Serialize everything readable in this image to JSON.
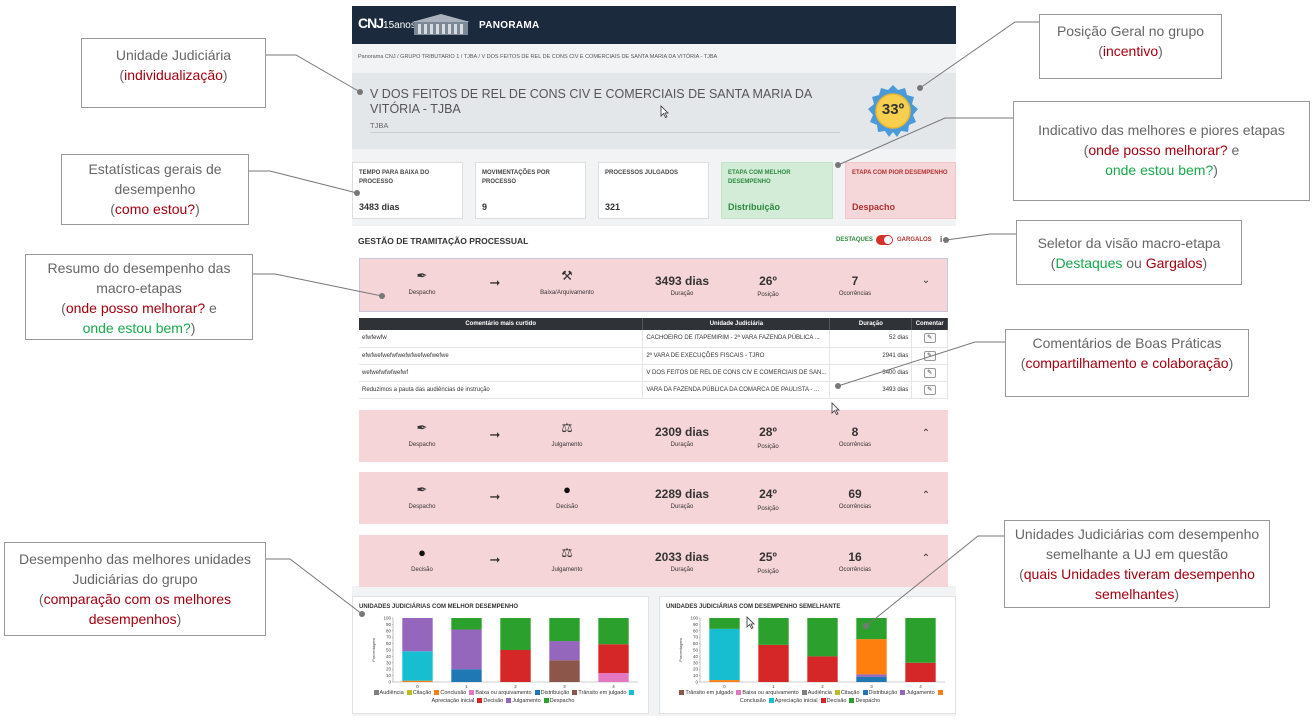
{
  "app": {
    "logo": "CNJ",
    "logo_sub": "15anos",
    "name": "PANORAMA"
  },
  "breadcrumb": "Panorama CNJ  /  GRUPO TRIBUTARIO 1  /  TJBA  /  V DOS FEITOS DE REL DE CONS CIV E COMERCIAIS DE SANTA MARIA DA VITÓRIA - TJBA",
  "unit": {
    "name": "V DOS FEITOS DE REL DE CONS CIV E COMERCIAIS DE SANTA MARIA DA VITÓRIA - TJBA",
    "court": "TJBA",
    "position": "33º"
  },
  "stats": [
    {
      "label": "TEMPO PARA BAIXA DO PROCESSO",
      "value": "3483 dias"
    },
    {
      "label": "MOVIMENTAÇÕES POR PROCESSO",
      "value": "9"
    },
    {
      "label": "PROCESSOS JULGADOS",
      "value": "321"
    },
    {
      "label": "ETAPA COM MELHOR DESEMPENHO",
      "value": "Distribuição"
    },
    {
      "label": "ETAPA COM PIOR DESEMPENHO",
      "value": "Despacho"
    }
  ],
  "section": {
    "title": "GESTÃO DE TRAMITAÇÃO PROCESSUAL",
    "toggle_left": "DESTAQUES",
    "toggle_right": "GARGALOS",
    "info": "i"
  },
  "labels": {
    "duration": "Duração",
    "position": "Posição",
    "occurrences": "Ocorrências",
    "arrow": "➞"
  },
  "stages": [
    {
      "from": "Despacho",
      "to": "Baixa/Arquivamento",
      "days": "3493 dias",
      "pos": "26º",
      "occ": "7",
      "chev": "⌄"
    },
    {
      "from": "Despacho",
      "to": "Julgamento",
      "days": "2309 dias",
      "pos": "28º",
      "occ": "8",
      "chev": "⌃"
    },
    {
      "from": "Despacho",
      "to": "Decisão",
      "days": "2289 dias",
      "pos": "24º",
      "occ": "69",
      "chev": "⌃"
    },
    {
      "from": "Decisão",
      "to": "Julgamento",
      "days": "2033 dias",
      "pos": "25º",
      "occ": "16",
      "chev": "⌃"
    }
  ],
  "comments": {
    "headers": [
      "Comentário mais curtido",
      "Unidade Judiciária",
      "Duração",
      "Comentar"
    ],
    "rows": [
      [
        "efwfewfw",
        "CACHOEIRO DE ITAPEMIRIM - 2ª VARA FAZENDA PÚBLICA ...",
        "52 dias"
      ],
      [
        "efwfwefwefwfwefwfwefwefwefwe",
        "2ª VARA DE EXECUÇÕES FISCAIS - TJRO",
        "2941 dias"
      ],
      [
        "wefwefwfwfwefwf",
        "V DOS FEITOS DE REL DE CONS CIV E COMERCIAIS DE SAN...",
        "3400 dias"
      ],
      [
        "Reduzimos a pauta das audiências de instrução",
        "VARA DA FAZENDA PÚBLICA DA COMARCA DE PAULISTA - ...",
        "3493 dias"
      ]
    ]
  },
  "chart_data": [
    {
      "type": "bar",
      "title": "UNIDADES JUDICIÁRIAS COM MELHOR DESEMPENHO",
      "ylabel": "Porcentagem",
      "ylim": [
        0,
        100
      ],
      "yticks": [
        "0",
        "10",
        "20",
        "30",
        "40",
        "50",
        "60",
        "70",
        "80",
        "90",
        "100"
      ],
      "categories": [
        "0",
        "1",
        "2",
        "3",
        "4"
      ],
      "stacked": true,
      "series": [
        {
          "name": "Audiência",
          "color": "#7f7f7f",
          "values": [
            0,
            0,
            0,
            0,
            0
          ]
        },
        {
          "name": "Citação",
          "color": "#bcbd22",
          "values": [
            0,
            0,
            0,
            0,
            0
          ]
        },
        {
          "name": "Conclusão",
          "color": "#ff7f0e",
          "values": [
            2,
            0,
            0,
            0,
            0
          ]
        },
        {
          "name": "Baixa ou arquivamento",
          "color": "#e377c2",
          "values": [
            0,
            0,
            0,
            0,
            14
          ]
        },
        {
          "name": "Distribuição",
          "color": "#1f77b4",
          "values": [
            0,
            20,
            0,
            0,
            0
          ]
        },
        {
          "name": "Trânsito em julgado",
          "color": "#8c564b",
          "values": [
            0,
            0,
            0,
            34,
            0
          ]
        },
        {
          "name": "Apreciação inicial",
          "color": "#17becf",
          "values": [
            46,
            0,
            0,
            0,
            0
          ]
        },
        {
          "name": "Decisão",
          "color": "#d62728",
          "values": [
            0,
            0,
            50,
            0,
            45
          ]
        },
        {
          "name": "Julgamento",
          "color": "#9467bd",
          "values": [
            52,
            62,
            0,
            30,
            0
          ]
        },
        {
          "name": "Despacho",
          "color": "#2ca02c",
          "values": [
            0,
            18,
            50,
            36,
            41
          ]
        }
      ]
    },
    {
      "type": "bar",
      "title": "UNIDADES JUDICIÁRIAS COM DESEMPENHO SEMELHANTE",
      "ylabel": "Porcentagem",
      "ylim": [
        0,
        100
      ],
      "yticks": [
        "0",
        "10",
        "20",
        "30",
        "40",
        "50",
        "60",
        "70",
        "80",
        "90",
        "100"
      ],
      "categories": [
        "0",
        "1",
        "2",
        "3",
        "4"
      ],
      "stacked": true,
      "series": [
        {
          "name": "Trânsito em julgado",
          "color": "#8c564b",
          "values": [
            0,
            0,
            0,
            0,
            0
          ]
        },
        {
          "name": "Baixa ou arquivamento",
          "color": "#e377c2",
          "values": [
            0,
            0,
            0,
            0,
            0
          ]
        },
        {
          "name": "Audiência",
          "color": "#7f7f7f",
          "values": [
            0,
            0,
            0,
            0,
            0
          ]
        },
        {
          "name": "Citação",
          "color": "#bcbd22",
          "values": [
            0,
            0,
            0,
            0,
            0
          ]
        },
        {
          "name": "Distribuição",
          "color": "#1f77b4",
          "values": [
            0,
            0,
            0,
            8,
            0
          ]
        },
        {
          "name": "Julgamento",
          "color": "#9467bd",
          "values": [
            0,
            0,
            0,
            4,
            0
          ]
        },
        {
          "name": "Conclusão",
          "color": "#ff7f0e",
          "values": [
            3,
            0,
            0,
            55,
            0
          ]
        },
        {
          "name": "Apreciação inicial",
          "color": "#17becf",
          "values": [
            80,
            0,
            0,
            0,
            0
          ]
        },
        {
          "name": "Decisão",
          "color": "#d62728",
          "values": [
            0,
            58,
            40,
            0,
            30
          ]
        },
        {
          "name": "Despacho",
          "color": "#2ca02c",
          "values": [
            17,
            42,
            60,
            33,
            70
          ]
        }
      ]
    }
  ],
  "annotations": [
    {
      "id": "a1",
      "lines": [
        [
          "Unidade Judiciária",
          ""
        ],
        [
          "(",
          ""
        ],
        [
          "individualização",
          "red"
        ],
        [
          ")",
          ""
        ]
      ]
    },
    {
      "id": "a2",
      "lines": [
        [
          "Posição Geral no grupo",
          ""
        ],
        [
          "(",
          ""
        ],
        [
          "incentivo",
          "red"
        ],
        [
          ")",
          ""
        ]
      ]
    },
    {
      "id": "a3",
      "lines": [
        [
          "Indicativo das melhores e piores etapas",
          ""
        ],
        [
          "(",
          ""
        ],
        [
          "onde posso melhorar?",
          "red"
        ],
        [
          " e",
          ""
        ],
        [
          "onde estou bem?",
          "grn"
        ],
        [
          ")",
          ""
        ]
      ]
    },
    {
      "id": "a4",
      "lines": [
        [
          "Estatísticas gerais de desempenho",
          ""
        ],
        [
          "(",
          ""
        ],
        [
          "como estou?",
          "red"
        ],
        [
          ")",
          ""
        ]
      ]
    },
    {
      "id": "a5",
      "lines": [
        [
          "Seletor da visão macro-etapa",
          ""
        ],
        [
          "(",
          ""
        ],
        [
          "Destaques",
          "grn"
        ],
        [
          " ou ",
          ""
        ],
        [
          "Gargalos",
          "red"
        ],
        [
          ")",
          ""
        ]
      ]
    },
    {
      "id": "a6",
      "lines": [
        [
          "Resumo do desempenho das macro-etapas",
          ""
        ],
        [
          "(",
          ""
        ],
        [
          "onde posso melhorar?",
          "red"
        ],
        [
          " e",
          ""
        ],
        [
          "onde estou bem?",
          "grn"
        ],
        [
          ")",
          ""
        ]
      ]
    },
    {
      "id": "a7",
      "lines": [
        [
          "Comentários de Boas Práticas",
          ""
        ],
        [
          "(",
          ""
        ],
        [
          "compartilhamento e colaboração",
          "red"
        ],
        [
          ")",
          ""
        ]
      ]
    },
    {
      "id": "a8",
      "lines": [
        [
          "Desempenho das melhores unidades Judiciárias do grupo",
          ""
        ],
        [
          "(",
          ""
        ],
        [
          "comparação com os melhores desempenhos",
          "red"
        ],
        [
          ")",
          ""
        ]
      ]
    },
    {
      "id": "a9",
      "lines": [
        [
          "Unidades Judiciárias com desempenho semelhante a UJ em questão",
          ""
        ],
        [
          "(",
          ""
        ],
        [
          "quais Unidades tiveram desempenho semelhantes",
          "red"
        ],
        [
          ")",
          ""
        ]
      ]
    }
  ],
  "colors": {
    "accent": "#1b2a3c",
    "good": "#2e8a3e",
    "bad": "#b23030",
    "annot_red": "#a3000f",
    "annot_green": "#17a84b"
  }
}
